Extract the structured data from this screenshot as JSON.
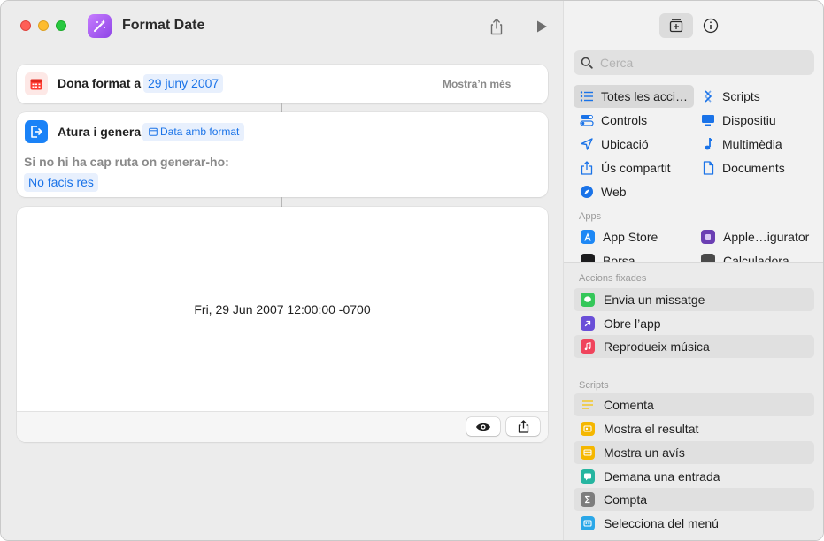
{
  "window": {
    "title": "Format Date"
  },
  "actions": [
    {
      "label": "Dona format a",
      "token": "29 juny 2007",
      "more": "Mostra’n més"
    },
    {
      "label": "Atura i genera",
      "token": "Data amb format",
      "subtitle": "Si no hi ha cap ruta on generar-ho:",
      "option": "No facis res"
    }
  ],
  "result": {
    "text": "Fri, 29 Jun 2007 12:00:00 -0700"
  },
  "sidebar": {
    "search_placeholder": "Cerca",
    "categories": [
      {
        "label": "Totes les acci…",
        "icon": "list-icon"
      },
      {
        "label": "Scripts",
        "icon": "scripts-icon"
      },
      {
        "label": "Controls",
        "icon": "toggle-icon"
      },
      {
        "label": "Dispositiu",
        "icon": "display-icon"
      },
      {
        "label": "Ubicació",
        "icon": "location-arrow-icon"
      },
      {
        "label": "Multimèdia",
        "icon": "music-note-icon"
      },
      {
        "label": "Ús compartit",
        "icon": "share-icon"
      },
      {
        "label": "Documents",
        "icon": "document-icon"
      },
      {
        "label": "Web",
        "icon": "compass-icon"
      }
    ],
    "apps_heading": "Apps",
    "apps": [
      {
        "label": "App Store",
        "color": "#1e88f5"
      },
      {
        "label": "Apple…igurator",
        "color": "#6b3fb3"
      },
      {
        "label": "Borsa",
        "color": "#1c1c1e"
      },
      {
        "label": "Calculadora",
        "color": "#4a4a4a"
      }
    ],
    "pinned_heading": "Accions fixades",
    "pinned": [
      {
        "label": "Envia un missatge",
        "color": "#34c759"
      },
      {
        "label": "Obre l’app",
        "color": "#6a4fd8"
      },
      {
        "label": "Reprodueix música",
        "color": "#f0445c"
      }
    ],
    "scripts_heading": "Scripts",
    "scripts": [
      {
        "label": "Comenta",
        "color": "#f5c518"
      },
      {
        "label": "Mostra el resultat",
        "color": "#f5b700"
      },
      {
        "label": "Mostra un avís",
        "color": "#f5b700"
      },
      {
        "label": "Demana una entrada",
        "color": "#26b5a0"
      },
      {
        "label": "Compta",
        "color": "#7d7d7d"
      },
      {
        "label": "Selecciona del menú",
        "color": "#2aa7e8"
      }
    ]
  }
}
